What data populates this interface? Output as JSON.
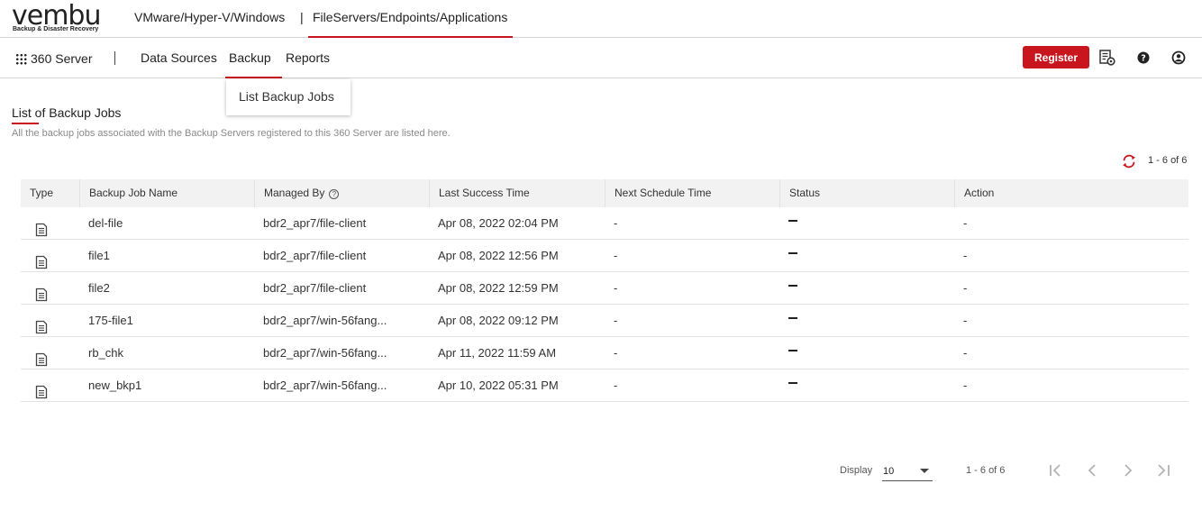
{
  "brand": {
    "logo_text": "vembu",
    "tagline": "Backup & Disaster Recovery"
  },
  "product_switcher": {
    "items": [
      {
        "label": "VMware/Hyper-V/Windows",
        "active": false
      },
      {
        "label": "FileServers/Endpoints/Applications",
        "active": true
      }
    ],
    "separator": "|"
  },
  "navbar": {
    "server_label": "360 Server",
    "items": [
      {
        "label": "Data Sources",
        "active": false
      },
      {
        "label": "Backup",
        "active": true
      },
      {
        "label": "Reports",
        "active": false
      }
    ],
    "register_label": "Register",
    "icons": [
      "server-settings-icon",
      "help-icon",
      "user-icon"
    ]
  },
  "dropdown": {
    "items": [
      {
        "label": "List Backup Jobs"
      }
    ]
  },
  "page": {
    "title": "List of Backup Jobs",
    "description": "All the backup jobs associated with the Backup Servers registered to this 360 Server are listed here.",
    "count_label": "1 - 6 of 6"
  },
  "table": {
    "columns": [
      "Type",
      "Backup Job Name",
      "Managed By",
      "Last Success Time",
      "Next Schedule Time",
      "Status",
      "Action"
    ],
    "rows": [
      {
        "name": "del-file",
        "managed_by": "bdr2_apr7/file-client",
        "last_success": "Apr 08, 2022 02:04 PM",
        "next_schedule": "-",
        "action": "-"
      },
      {
        "name": "file1",
        "managed_by": "bdr2_apr7/file-client",
        "last_success": "Apr 08, 2022 12:56 PM",
        "next_schedule": "-",
        "action": "-"
      },
      {
        "name": "file2",
        "managed_by": "bdr2_apr7/file-client",
        "last_success": "Apr 08, 2022 12:59 PM",
        "next_schedule": "-",
        "action": "-"
      },
      {
        "name": "175-file1",
        "managed_by": "bdr2_apr7/win-56fang...",
        "last_success": "Apr 08, 2022 09:12 PM",
        "next_schedule": "-",
        "action": "-"
      },
      {
        "name": "rb_chk",
        "managed_by": "bdr2_apr7/win-56fang...",
        "last_success": "Apr 11, 2022 11:59 AM",
        "next_schedule": "-",
        "action": "-"
      },
      {
        "name": "new_bkp1",
        "managed_by": "bdr2_apr7/win-56fang...",
        "last_success": "Apr 10, 2022 05:31 PM",
        "next_schedule": "-",
        "action": "-"
      }
    ]
  },
  "pagination": {
    "display_label": "Display",
    "page_size": "10",
    "count_label": "1 - 6 of 6"
  },
  "colors": {
    "accent": "#c9161e",
    "header_bg": "#f2f2f2"
  }
}
